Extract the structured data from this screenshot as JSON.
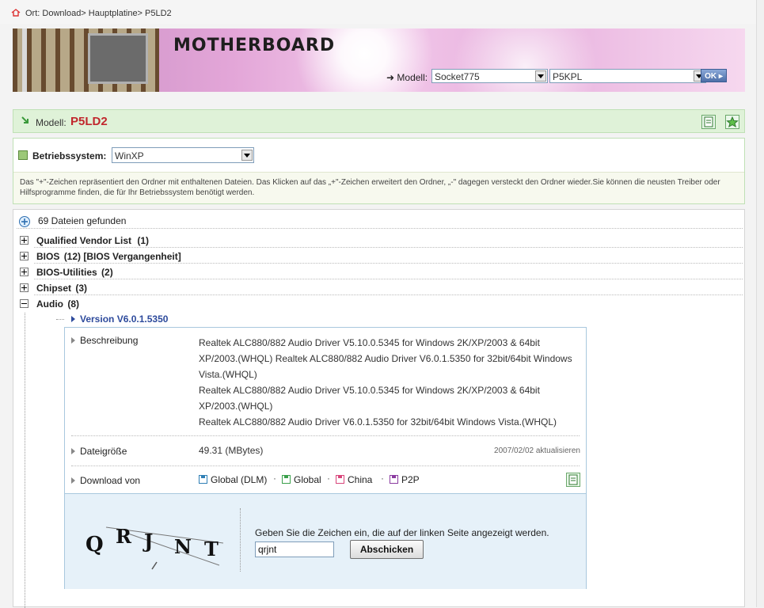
{
  "breadcrumb": {
    "text": "Ort: Download> Hauptplatine> P5LD2"
  },
  "banner": {
    "title": "MOTHERBOARD",
    "modell_label": "Modell:",
    "socket_value": "Socket775",
    "model_value": "P5KPL",
    "ok_label": "OK"
  },
  "model_header": {
    "label": "Modell:",
    "value": "P5LD2"
  },
  "os": {
    "label": "Betriebssystem:",
    "value": "WinXP",
    "info": "Das \"+\"-Zeichen repräsentiert den Ordner mit enthaltenen Dateien. Das Klicken auf das „+\"-Zeichen erweitert den Ordner, „-\" dagegen versteckt den Ordner wieder.Sie können die neusten Treiber oder Hilfsprogramme finden, die für Ihr Betriebssystem benötigt werden."
  },
  "files": {
    "count_text": "69 Dateien gefunden",
    "categories": [
      {
        "name": "Qualified Vendor List",
        "count": "(1)",
        "extra": "",
        "expanded": false
      },
      {
        "name": "BIOS",
        "count": "(12)",
        "extra": "[BIOS Vergangenheit]",
        "expanded": false
      },
      {
        "name": "BIOS-Utilities",
        "count": "(2)",
        "extra": "",
        "expanded": false
      },
      {
        "name": "Chipset",
        "count": "(3)",
        "extra": "",
        "expanded": false
      },
      {
        "name": "Audio",
        "count": "(8)",
        "extra": "",
        "expanded": true
      }
    ]
  },
  "audio_item": {
    "version": "Version V6.0.1.5350",
    "desc_label": "Beschreibung",
    "description_lines": [
      "Realtek ALC880/882 Audio Driver V5.10.0.5345 for Windows 2K/XP/2003 & 64bit",
      "XP/2003.(WHQL) Realtek ALC880/882 Audio Driver V6.0.1.5350 for 32bit/64bit Windows",
      "Vista.(WHQL)",
      "Realtek ALC880/882 Audio Driver V5.10.0.5345 for Windows 2K/XP/2003 & 64bit",
      "XP/2003.(WHQL)",
      "Realtek ALC880/882 Audio Driver V6.0.1.5350 for 32bit/64bit Windows Vista.(WHQL)"
    ],
    "size_label": "Dateigröße",
    "size_value": "49.31 (MBytes)",
    "updated": "2007/02/02 aktualisieren",
    "download_label": "Download von",
    "download_links": [
      {
        "label": "Global (DLM)",
        "color": "#2f7fb5"
      },
      {
        "label": "Global",
        "color": "#3aa04b"
      },
      {
        "label": "China",
        "color": "#d8457a"
      },
      {
        "label": "P2P",
        "color": "#8a3aa0"
      }
    ]
  },
  "captcha": {
    "chars": [
      "Q",
      "R",
      "J",
      "N",
      "T"
    ],
    "instruction": "Geben Sie die Zeichen ein, die auf der linken Seite angezeigt werden.",
    "input_value": "qrjnt",
    "submit_label": "Abschicken"
  }
}
